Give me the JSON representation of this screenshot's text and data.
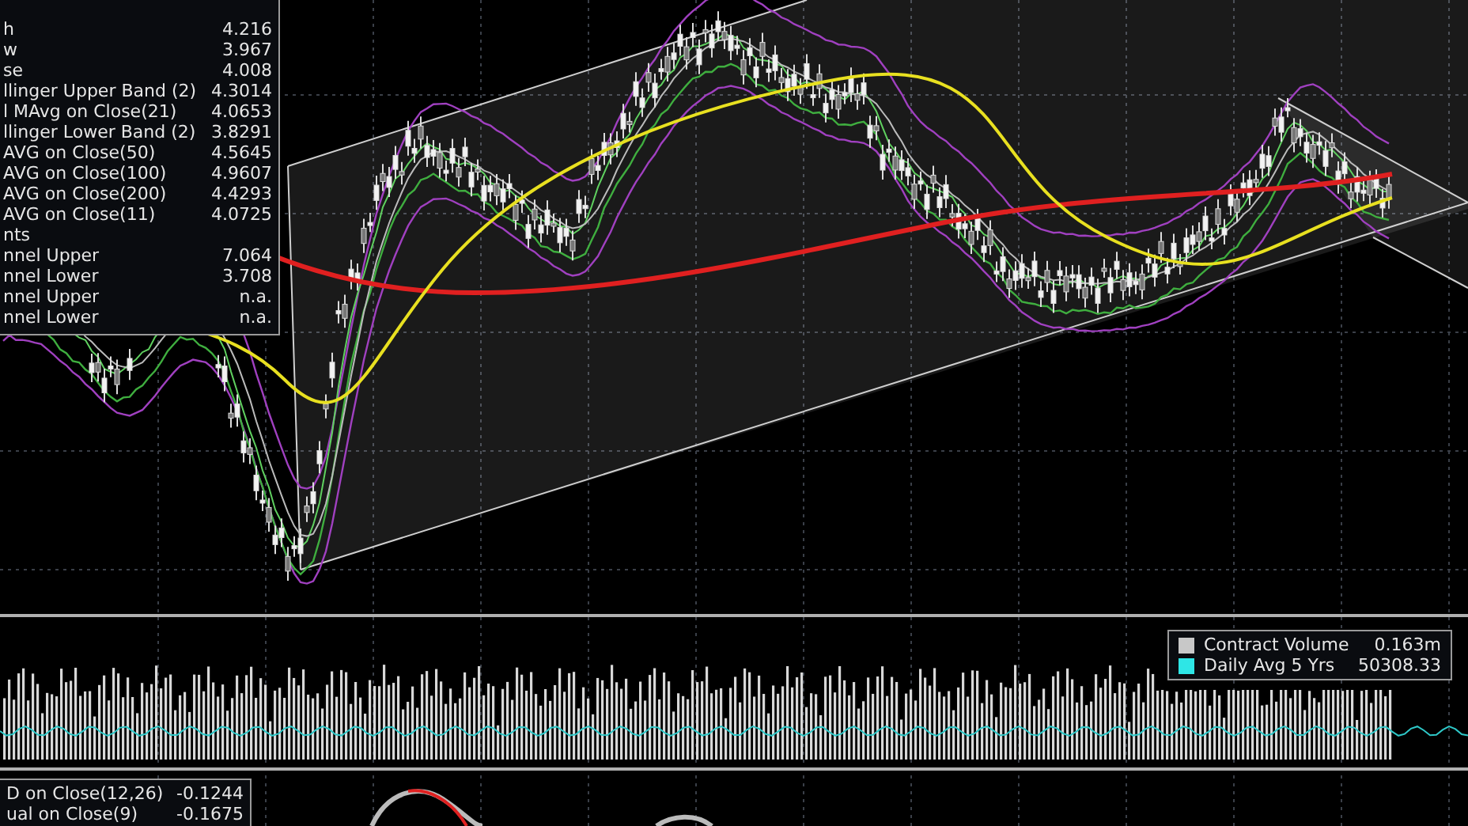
{
  "legend": {
    "rows": [
      {
        "label": "h",
        "value": "4.216"
      },
      {
        "label": "w",
        "value": "3.967"
      },
      {
        "label": "se",
        "value": "4.008"
      },
      {
        "label": "llinger Upper Band (2)",
        "value": "4.3014"
      },
      {
        "label": "l MAvg on Close(21)",
        "value": "4.0653"
      },
      {
        "label": "llinger Lower Band (2)",
        "value": "3.8291"
      },
      {
        "label": "AVG on Close(50)",
        "value": "4.5645"
      },
      {
        "label": "AVG on Close(100)",
        "value": "4.9607"
      },
      {
        "label": "AVG on Close(200)",
        "value": "4.4293"
      },
      {
        "label": "AVG on Close(11)",
        "value": "4.0725"
      },
      {
        "label": "nts"
      },
      {
        "label": "nnel Upper",
        "value": "7.064"
      },
      {
        "label": "nnel Lower",
        "value": "3.708"
      },
      {
        "label": "nnel Upper",
        "value": "n.a."
      },
      {
        "label": "nnel Lower",
        "value": "n.a."
      }
    ]
  },
  "volume_legend": {
    "rows": [
      {
        "label": "Contract Volume",
        "value": "0.163m",
        "color": "#c8c8c8"
      },
      {
        "label": "Daily Avg 5 Yrs",
        "value": "50308.33",
        "color": "#2ee6e6"
      }
    ]
  },
  "macd_legend": {
    "rows": [
      {
        "label": "D on Close(12,26)",
        "value": "-0.1244"
      },
      {
        "label": "ual on Close(9)",
        "value": "-0.1675"
      }
    ]
  }
}
